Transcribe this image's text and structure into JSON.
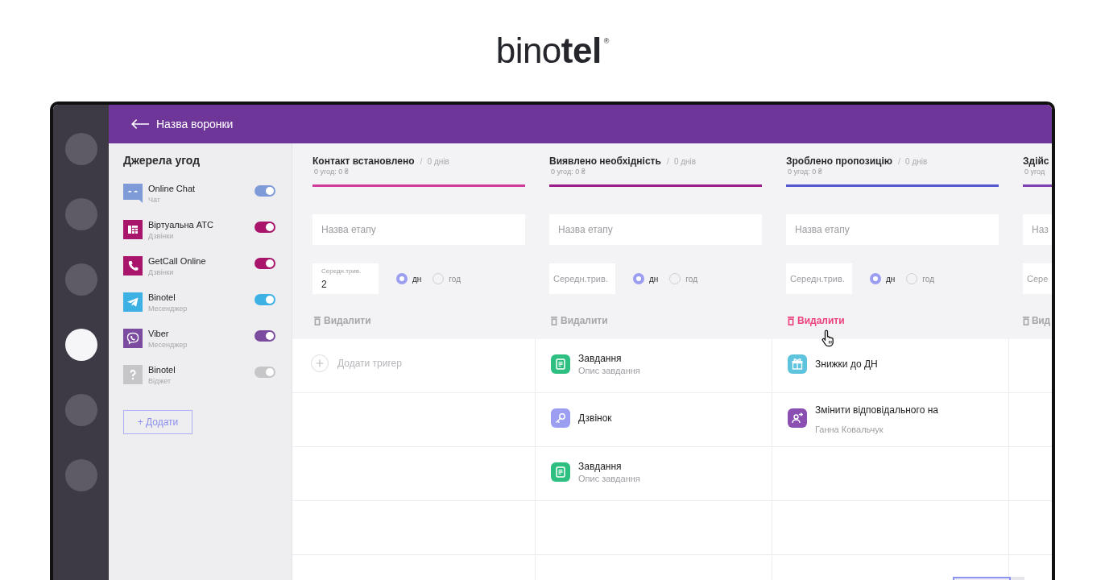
{
  "logo": {
    "text": "bino**tel**$^{®}$"
  },
  "rail": [
    {
      "selected": false
    },
    {
      "selected": false
    },
    {
      "selected": false
    },
    {
      "selected": true
    },
    {
      "selected": false
    },
    {
      "selected": false
    }
  ],
  "top_bar": {
    "title": "Назва воронки"
  },
  "sidebar": {
    "title": "Джерела угод",
    "sources": [
      {
        "kind": "chat",
        "name": "Online Chat",
        "type": "Чат",
        "color": "#7f9bd7",
        "on": true
      },
      {
        "kind": "pbx",
        "name": "Віртуальна АТС",
        "type": "Дзвінки",
        "color": "#a8156a",
        "on": true
      },
      {
        "kind": "phone",
        "name": "GetCall Online",
        "type": "Дзвінки",
        "color": "#a8156a",
        "on": true
      },
      {
        "kind": "telegram",
        "name": "Binotel",
        "type": "Месенджер",
        "color": "#3eb1e4",
        "on": true
      },
      {
        "kind": "viber",
        "name": "Viber",
        "type": "Месенджер",
        "color": "#7b4b9f",
        "on": true
      },
      {
        "kind": "widget",
        "name": "Binotel",
        "type": "Віджет",
        "color": "#c6c6c8",
        "on": true
      }
    ],
    "add_button": "+ Додати"
  },
  "stages": [
    {
      "title": "Контакт встановлено",
      "separator": "/",
      "duration": "0 днів",
      "summary": "0 угод: 0 ₴",
      "color": "#d03b9b",
      "name_field": {
        "placeholder": "Назва етапу"
      },
      "duration_field": {
        "label": "Середн.трив.",
        "value": "2"
      },
      "units": [
        {
          "label": "дн",
          "selected": true
        },
        {
          "label": "год",
          "selected": false
        }
      ],
      "delete": {
        "label": "Видалити",
        "hovered": false
      },
      "add_trigger": "Додати тригер"
    },
    {
      "title": "Виявлено необхідність",
      "separator": "/",
      "duration": "0 днів",
      "summary": "0 угод: 0 ₴",
      "color": "#9b1b8b",
      "name_field": {
        "placeholder": "Назва етапу"
      },
      "duration_field": {
        "placeholder": "Середн.трив."
      },
      "units": [
        {
          "label": "дн",
          "selected": true
        },
        {
          "label": "год",
          "selected": false
        }
      ],
      "delete": {
        "label": "Видалити",
        "hovered": false
      },
      "triggers": [
        {
          "kind": "task",
          "title": "Завдання",
          "description": "Опис завдання"
        },
        {
          "kind": "call",
          "title": "Дзвінок"
        },
        {
          "kind": "task",
          "title": "Завдання",
          "description": "Опис завдання"
        }
      ]
    },
    {
      "title": "Зроблено пропозицію",
      "separator": "/",
      "duration": "0 днів",
      "summary": "0 угод: 0 ₴",
      "color": "#5356cc",
      "name_field": {
        "placeholder": "Назва етапу"
      },
      "duration_field": {
        "placeholder": "Середн.трив."
      },
      "units": [
        {
          "label": "дн",
          "selected": true
        },
        {
          "label": "год",
          "selected": false
        }
      ],
      "delete": {
        "label": "Видалити",
        "hovered": true
      },
      "triggers": [
        {
          "kind": "gift",
          "title": "Знижки до ДН"
        },
        {
          "kind": "reassign",
          "title": "Змінити відповідального на",
          "description": "Ганна Ковальчук"
        }
      ]
    },
    {
      "title": "Здійс",
      "summary": "0 угод",
      "color": "#7d40b0",
      "name_field": {
        "placeholder": "Наз"
      },
      "duration_field": {
        "placeholder": "Сере"
      },
      "delete": {
        "label": "Вид",
        "hovered": false
      }
    }
  ]
}
